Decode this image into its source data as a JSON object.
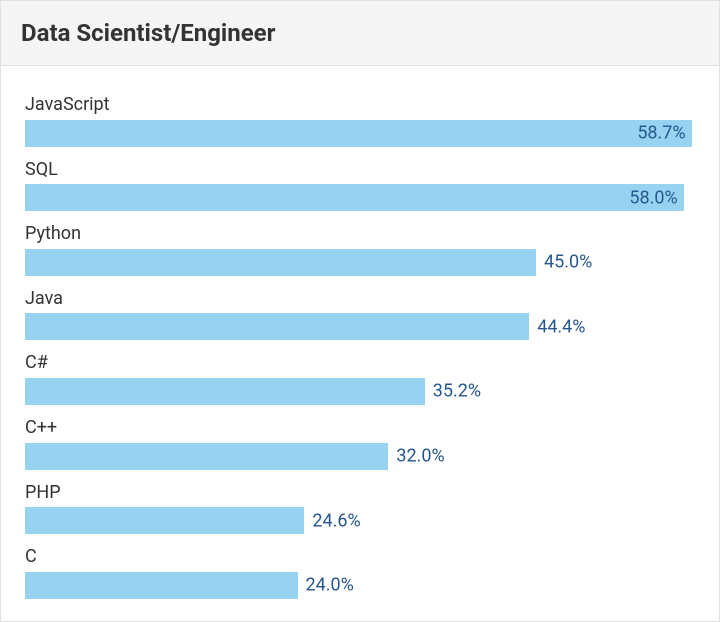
{
  "title": "Data Scientist/Engineer",
  "scale_max": 59,
  "chart_data": {
    "type": "bar",
    "title": "Data Scientist/Engineer",
    "xlabel": "",
    "ylabel": "",
    "categories": [
      "JavaScript",
      "SQL",
      "Python",
      "Java",
      "C#",
      "C++",
      "PHP",
      "C"
    ],
    "values": [
      58.7,
      58.0,
      45.0,
      44.4,
      35.2,
      32.0,
      24.6,
      24.0
    ],
    "value_labels": [
      "58.7%",
      "58.0%",
      "45.0%",
      "44.4%",
      "35.2%",
      "32.0%",
      "24.6%",
      "24.0%"
    ],
    "xlim": [
      0,
      59
    ]
  }
}
